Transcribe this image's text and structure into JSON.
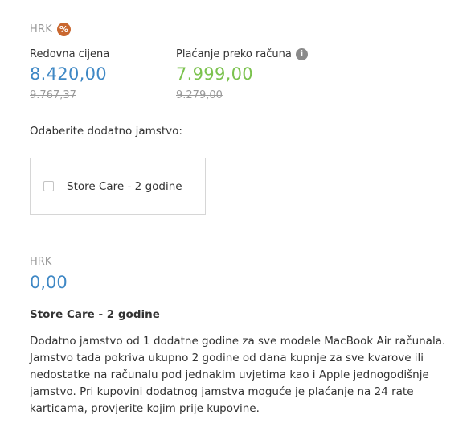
{
  "pricing": {
    "currency": "HRK",
    "discount_badge": "%",
    "regular": {
      "label": "Redovna cijena",
      "price": "8.420,00",
      "old_price": "9.767,37"
    },
    "invoice": {
      "label": "Plaćanje preko računa",
      "info_icon": "i",
      "price": "7.999,00",
      "old_price": "9.279,00"
    }
  },
  "warranty": {
    "heading": "Odaberite dodatno jamstvo:",
    "option_label": "Store Care - 2 godine",
    "checked": false
  },
  "summary": {
    "currency": "HRK",
    "total": "0,00",
    "product_title": "Store Care - 2 godine",
    "description_lines": [
      "Dodatno jamstvo od 1 dodatne godine za sve modele MacBook Air računala.",
      "Jamstvo tada pokriva ukupno 2 godine od dana kupnje za sve kvarove ili",
      "nedostatke na računalu pod jednakim uvjetima kao i Apple jednogodišnje",
      "jamstvo. Pri kupovini dodatnog jamstva moguće je plaćanje na 24 rate",
      "karticama, provjerite kojim prije kupovine."
    ]
  },
  "colors": {
    "regular_price": "#3f88c5",
    "invoice_price": "#7bc24e",
    "discount_badge": "#c9672f"
  }
}
